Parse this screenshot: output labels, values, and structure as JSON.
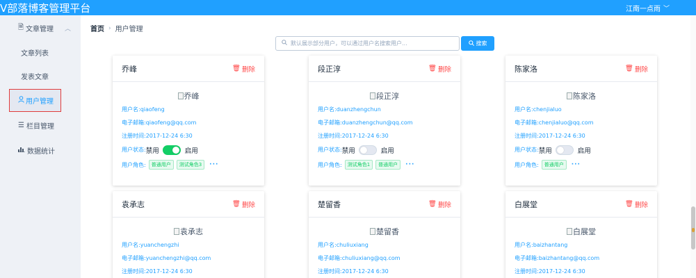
{
  "header": {
    "app_title": "V部落博客管理平台",
    "user_name": "江南一点雨",
    "user_chevron": "﹀"
  },
  "sidebar": {
    "group_label": "文章管理",
    "group_arrow": "︿",
    "sub_items": [
      "文章列表",
      "发表文章"
    ],
    "active_item": "用户管理",
    "items": [
      "栏目管理",
      "数据统计"
    ]
  },
  "breadcrumb": {
    "home": "首页",
    "separator": "›",
    "current": "用户管理"
  },
  "search": {
    "placeholder": "默认展示部分用户，可以通过用户名搜索用户...",
    "button_label": "搜索"
  },
  "labels": {
    "delete": "删除",
    "username_prefix": "用户名:",
    "email_prefix": "电子邮箱:",
    "register_prefix": "注册时间:",
    "status_prefix": "用户状态:",
    "disable": "禁用",
    "enable": "启用",
    "roles_prefix": "用户角色:",
    "more": "···"
  },
  "users": [
    {
      "name": "乔峰",
      "username": "qiaofeng",
      "email": "qiaofeng@qq.com",
      "registered": "2017-12-24 6:30",
      "enabled": true,
      "roles": [
        "普通用户",
        "测试角色3"
      ]
    },
    {
      "name": "段正淳",
      "username": "duanzhengchun",
      "email": "duanzhengchun@qq.com",
      "registered": "2017-12-24 6:30",
      "enabled": false,
      "roles": [
        "测试角色1",
        "普通用户"
      ]
    },
    {
      "name": "陈家洛",
      "username": "chenjialuo",
      "email": "chenjialuo@qq.com",
      "registered": "2017-12-24 6:30",
      "enabled": false,
      "roles": [
        "普通用户"
      ]
    },
    {
      "name": "袁承志",
      "username": "yuanchengzhi",
      "email": "yuanchengzhi@qq.com",
      "registered": "2017-12-24 6:30"
    },
    {
      "name": "楚留香",
      "username": "chuliuxiang",
      "email": "chuliuxiang@qq.com",
      "registered": "2017-12-24 6:30"
    },
    {
      "name": "白展堂",
      "username": "baizhantang",
      "email": "baizhantang@qq.com",
      "registered": "2017-12-24 6:30"
    }
  ],
  "colors": {
    "primary": "#20a0ff",
    "danger": "#ff4949",
    "success": "#13ce66",
    "sidebar_bg": "#eef1f6"
  }
}
